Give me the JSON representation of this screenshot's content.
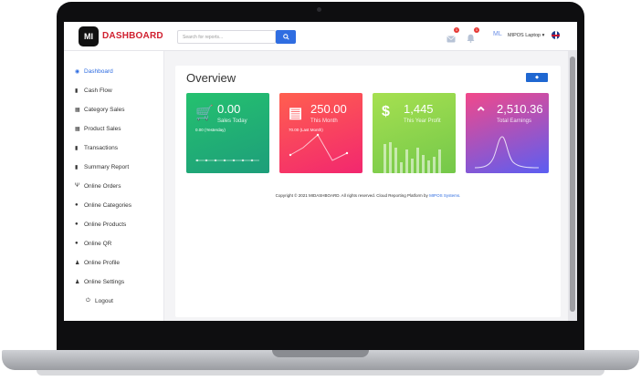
{
  "app": {
    "logo_text": "MI",
    "brand": "DASHBOARD"
  },
  "topbar": {
    "search_placeholder": "Search for reports...",
    "search_icon": "search-icon",
    "mail_badge": "1",
    "bell_badge": "1",
    "avatar_initials": "ML",
    "store_name": "MIPOS Laptop",
    "flag": "uk-flag"
  },
  "sidebar": {
    "items": [
      {
        "label": "Dashboard",
        "icon": "palette-icon",
        "active": true
      },
      {
        "label": "Cash Flow",
        "icon": "bar-chart-icon"
      },
      {
        "label": "Category Sales",
        "icon": "table-icon"
      },
      {
        "label": "Product Sales",
        "icon": "table-icon"
      },
      {
        "label": "Transactions",
        "icon": "bar-chart-icon"
      },
      {
        "label": "Summary Report",
        "icon": "bar-chart-icon"
      },
      {
        "label": "Online Orders",
        "icon": "utensils-icon"
      },
      {
        "label": "Online Categories",
        "icon": "globe-icon"
      },
      {
        "label": "Online Products",
        "icon": "globe-icon"
      },
      {
        "label": "Online QR",
        "icon": "globe-icon"
      },
      {
        "label": "Online Profile",
        "icon": "user-icon"
      },
      {
        "label": "Online Settings",
        "icon": "user-icon"
      },
      {
        "label": "Logout",
        "icon": "power-icon"
      }
    ]
  },
  "main": {
    "title": "Overview",
    "cards": [
      {
        "value": "0.00",
        "label": "Sales Today",
        "note": "0.00 (Yesterday)",
        "icon": "cart-icon",
        "colors": [
          "#25c16f",
          "#1d9e7a"
        ]
      },
      {
        "value": "250.00",
        "label": "This Month",
        "note": "70.00 (Last Month)",
        "icon": "calendar-icon",
        "colors": [
          "#ff5f4f",
          "#f2276f"
        ]
      },
      {
        "value": "1,445",
        "label": "This Year Profit",
        "note": "",
        "icon": "dollar-icon",
        "colors": [
          "#9edb4a",
          "#74c84a"
        ]
      },
      {
        "value": "2,510.36",
        "label": "Total Earnings",
        "note": "",
        "icon": "chevron-up-icon",
        "colors": [
          "#f2488a",
          "#5b5ef2"
        ]
      }
    ],
    "footer_text": "Copyright © 2021 MIDASHBOARD. All rights reserved. Cloud Reporting Platform by",
    "footer_link": "MIPOS Systems."
  }
}
